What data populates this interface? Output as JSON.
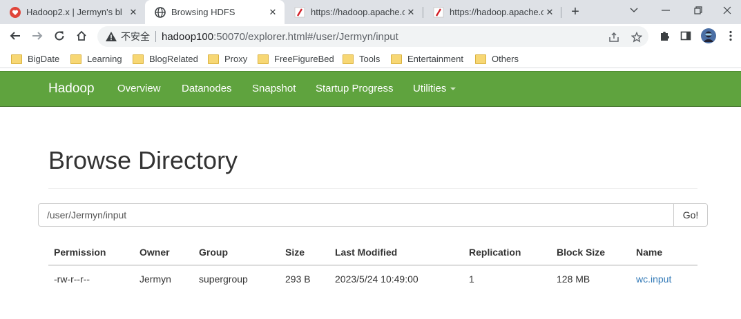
{
  "browser": {
    "tabs": [
      {
        "title": "Hadoop2.x | Jermyn's bl",
        "icon": "vivaldi-heart-icon",
        "active": false
      },
      {
        "title": "Browsing HDFS",
        "icon": "globe-icon",
        "active": true
      },
      {
        "title": "https://hadoop.apache.o",
        "icon": "apache-feather-icon",
        "active": false
      },
      {
        "title": "https://hadoop.apache.o",
        "icon": "apache-feather-icon",
        "active": false
      }
    ],
    "omnibox": {
      "security_label": "不安全",
      "url_host": "hadoop100",
      "url_rest": ":50070/explorer.html#/user/Jermyn/input"
    },
    "bookmarks": [
      {
        "label": "BigDate"
      },
      {
        "label": "Learning"
      },
      {
        "label": "BlogRelated"
      },
      {
        "label": "Proxy"
      },
      {
        "label": "FreeFigureBed"
      },
      {
        "label": "Tools"
      },
      {
        "label": "Entertainment"
      },
      {
        "label": "Others"
      }
    ]
  },
  "navbar": {
    "brand": "Hadoop",
    "links": [
      "Overview",
      "Datanodes",
      "Snapshot",
      "Startup Progress",
      "Utilities"
    ],
    "color": "#5fa33e"
  },
  "page": {
    "title": "Browse Directory",
    "path_value": "/user/Jermyn/input",
    "go_label": "Go!",
    "table": {
      "headers": [
        "Permission",
        "Owner",
        "Group",
        "Size",
        "Last Modified",
        "Replication",
        "Block Size",
        "Name"
      ],
      "rows": [
        [
          "-rw-r--r--",
          "Jermyn",
          "supergroup",
          "293 B",
          "2023/5/24 10:49:00",
          "1",
          "128 MB",
          "wc.input"
        ]
      ]
    },
    "link_color": "#337ab7"
  }
}
